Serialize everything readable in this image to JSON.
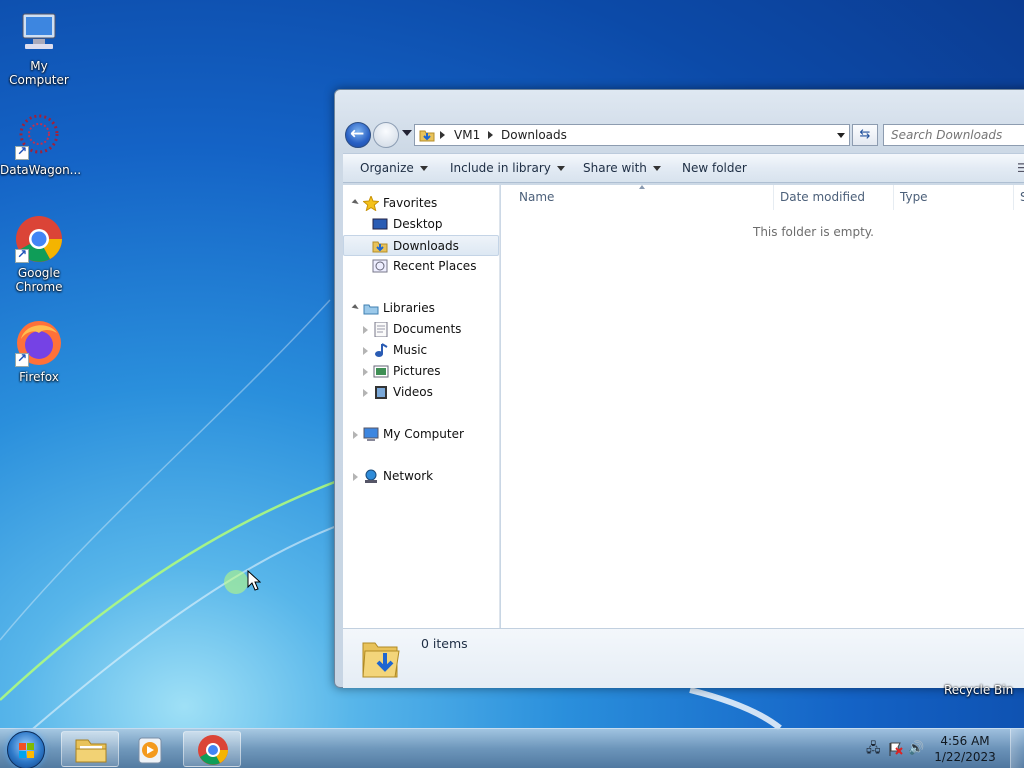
{
  "desktop": {
    "icons": [
      {
        "label": "My Computer",
        "icon": "computer-icon"
      },
      {
        "label": "DataWagon...",
        "icon": "datawagon-icon"
      },
      {
        "label": "Google Chrome",
        "icon": "chrome-icon"
      },
      {
        "label": "Firefox",
        "icon": "firefox-icon"
      }
    ],
    "recycle_bin_label": "Recycle Bin"
  },
  "explorer": {
    "breadcrumb": [
      "VM1",
      "Downloads"
    ],
    "search_placeholder": "Search Downloads",
    "toolbar": {
      "organize": "Organize",
      "include_in_library": "Include in library",
      "share_with": "Share with",
      "new_folder": "New folder"
    },
    "nav": {
      "favorites": "Favorites",
      "desktop": "Desktop",
      "downloads": "Downloads",
      "recent_places": "Recent Places",
      "libraries": "Libraries",
      "documents": "Documents",
      "music": "Music",
      "pictures": "Pictures",
      "videos": "Videos",
      "my_computer": "My Computer",
      "network": "Network"
    },
    "columns": {
      "name": "Name",
      "date_modified": "Date modified",
      "type": "Type",
      "size": "S"
    },
    "empty_message": "This folder is empty.",
    "item_count": "0 items"
  },
  "taskbar": {
    "apps": [
      "explorer-icon",
      "media-player-icon",
      "chrome-icon"
    ],
    "clock": {
      "time": "4:56 AM",
      "date": "1/22/2023"
    }
  }
}
